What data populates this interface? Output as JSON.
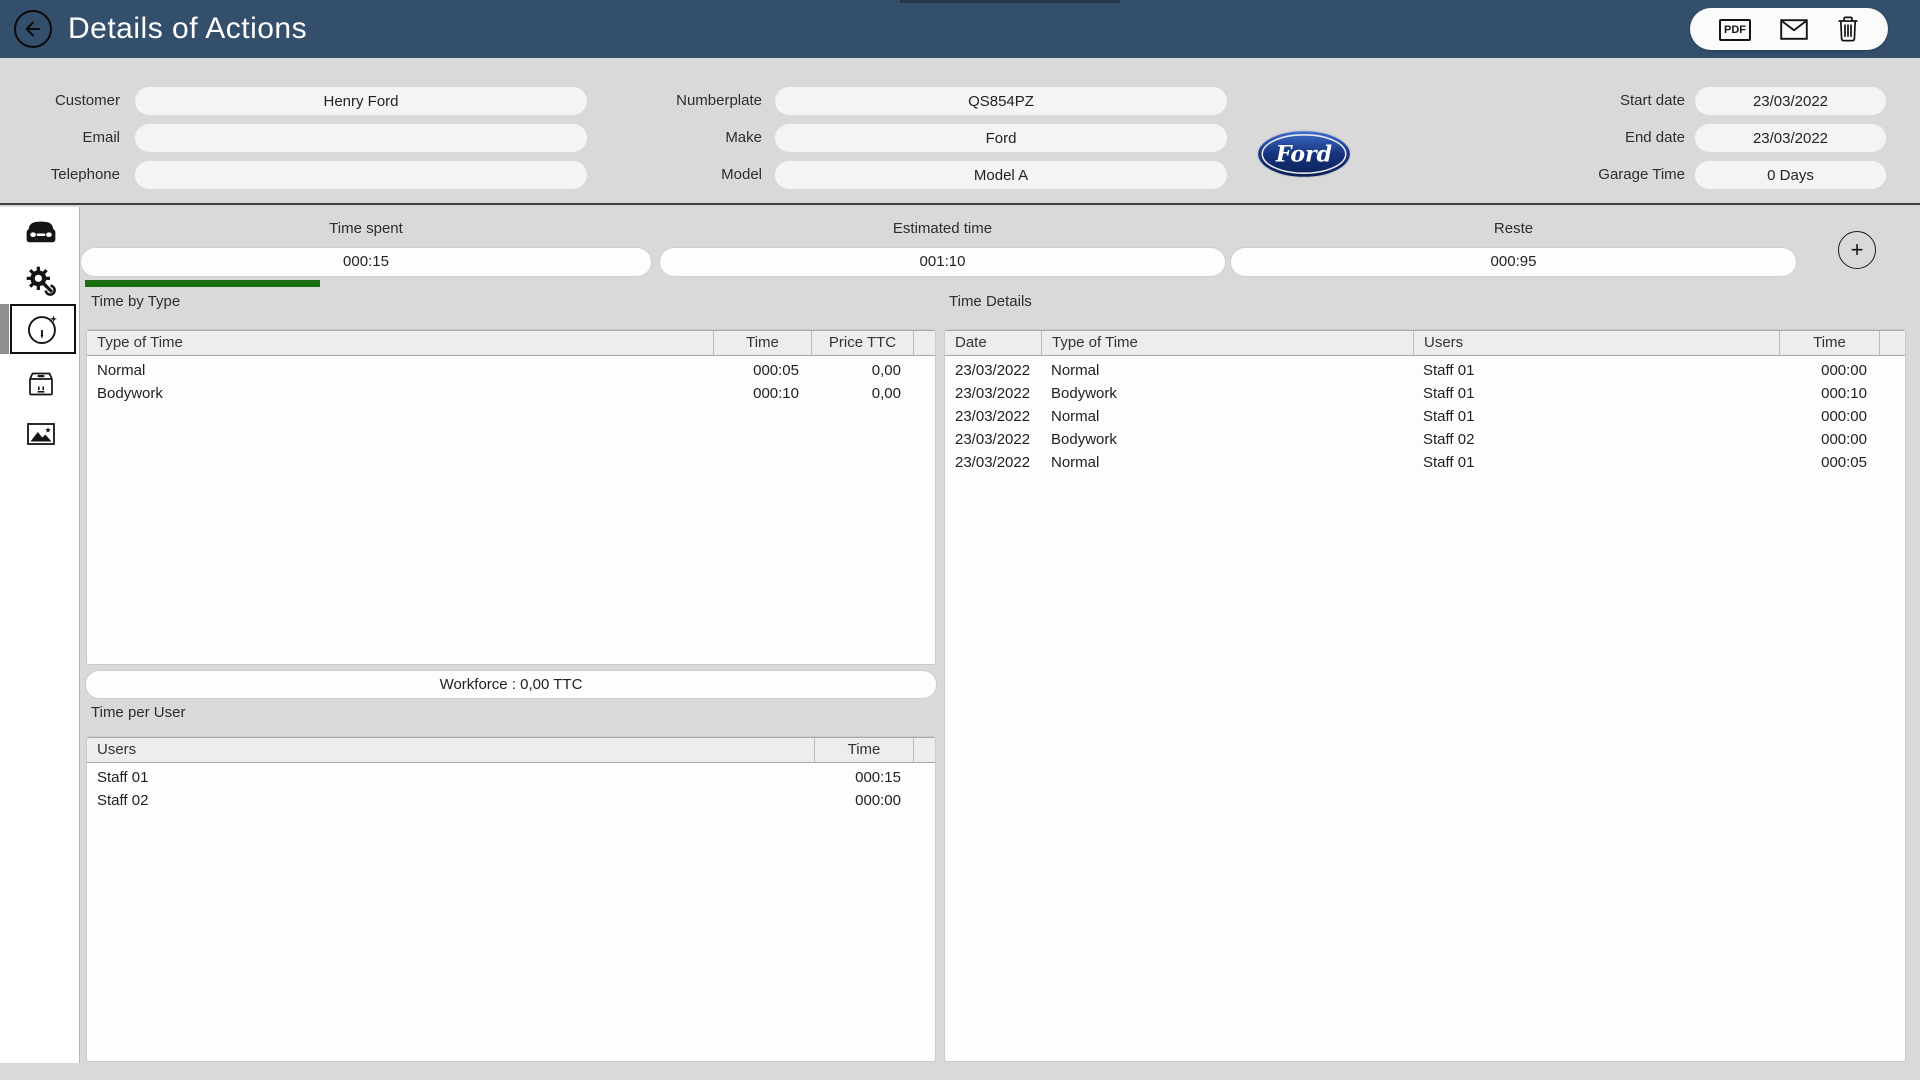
{
  "header": {
    "title": "Details of Actions",
    "pdf_label": "PDF"
  },
  "vehicle_form": {
    "customer": {
      "label": "Customer",
      "value": "Henry Ford"
    },
    "email": {
      "label": "Email",
      "value": ""
    },
    "telephone": {
      "label": "Telephone",
      "value": ""
    },
    "numberplate": {
      "label": "Numberplate",
      "value": "QS854PZ"
    },
    "make": {
      "label": "Make",
      "value": "Ford"
    },
    "model": {
      "label": "Model",
      "value": "Model A"
    },
    "start_date": {
      "label": "Start date",
      "value": "23/03/2022"
    },
    "end_date": {
      "label": "End date",
      "value": "23/03/2022"
    },
    "garage_time": {
      "label": "Garage Time",
      "value": "0 Days"
    },
    "brand_logo_text": "Ford"
  },
  "time_summary": {
    "time_spent": {
      "label": "Time spent",
      "value": "000:15",
      "progress_pct": 41
    },
    "estimated_time": {
      "label": "Estimated time",
      "value": "001:10"
    },
    "reste": {
      "label": "Reste",
      "value": "000:95"
    },
    "add_button": "+"
  },
  "time_by_type": {
    "title": "Time by Type",
    "columns": [
      "Type of Time",
      "Time",
      "Price TTC"
    ],
    "rows": [
      [
        "Normal",
        "000:05",
        "0,00"
      ],
      [
        "Bodywork",
        "000:10",
        "0,00"
      ]
    ]
  },
  "workforce_bar": {
    "text": "Workforce : 0,00 TTC"
  },
  "time_per_user": {
    "title": "Time per User",
    "columns": [
      "Users",
      "Time"
    ],
    "rows": [
      [
        "Staff 01",
        "000:15"
      ],
      [
        "Staff 02",
        "000:00"
      ]
    ]
  },
  "time_details": {
    "title": "Time Details",
    "columns": [
      "Date",
      "Type of Time",
      "Users",
      "Time"
    ],
    "rows": [
      [
        "23/03/2022",
        "Normal",
        "Staff 01",
        "000:00"
      ],
      [
        "23/03/2022",
        "Bodywork",
        "Staff 01",
        "000:10"
      ],
      [
        "23/03/2022",
        "Normal",
        "Staff 01",
        "000:00"
      ],
      [
        "23/03/2022",
        "Bodywork",
        "Staff 02",
        "000:00"
      ],
      [
        "23/03/2022",
        "Normal",
        "Staff 01",
        "000:05"
      ]
    ]
  }
}
